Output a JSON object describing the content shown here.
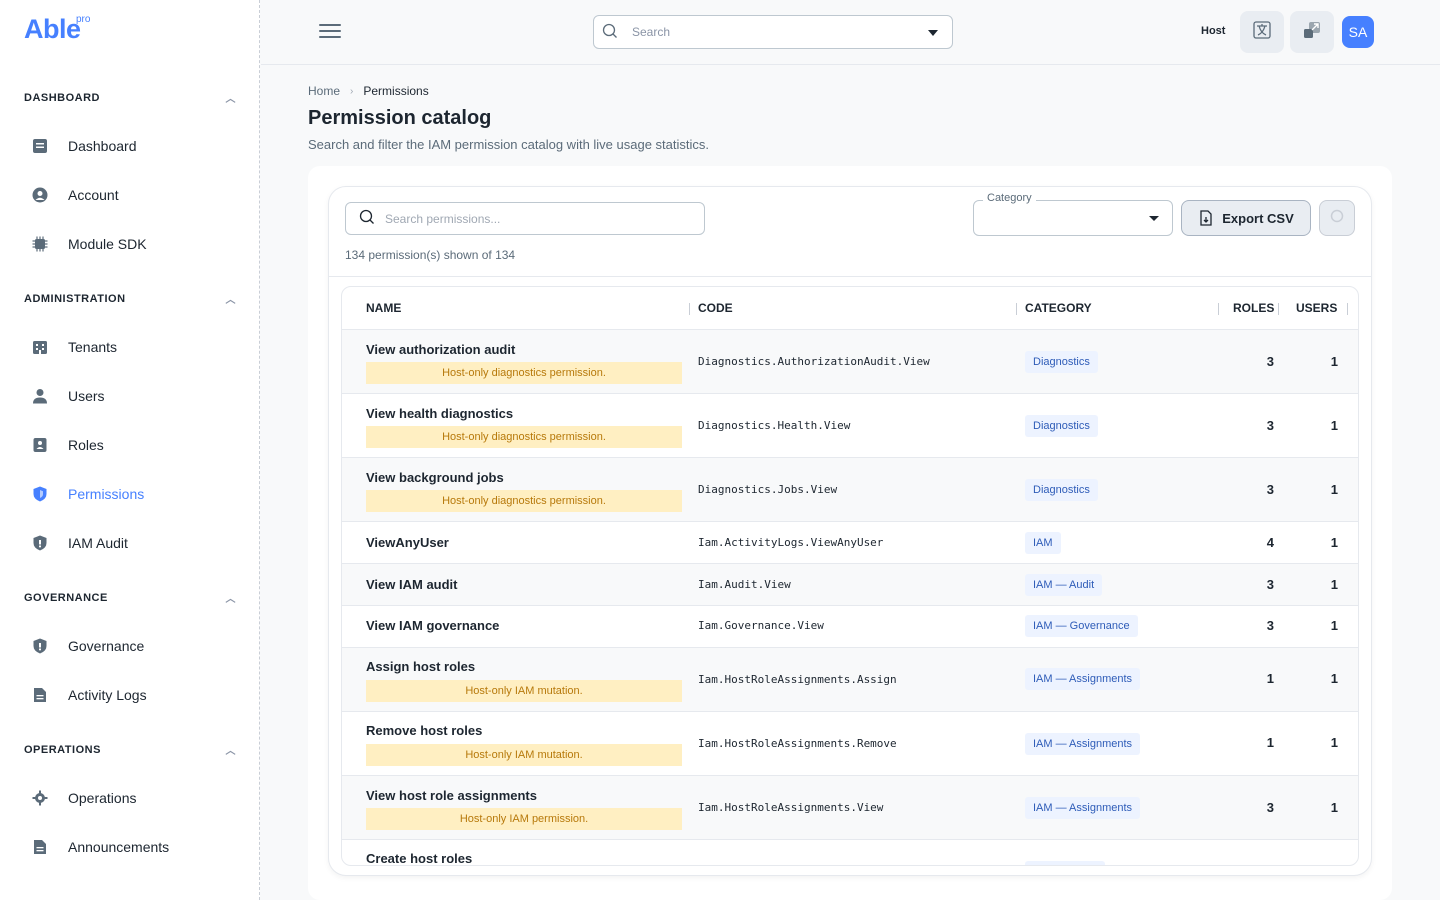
{
  "brand": {
    "name": "Able",
    "badge": "pro",
    "accent": "#4680ff"
  },
  "sidebar": {
    "sections": [
      {
        "label": "DASHBOARD",
        "items": [
          {
            "label": "Dashboard",
            "icon": "dashboard-icon"
          },
          {
            "label": "Account",
            "icon": "account-icon"
          },
          {
            "label": "Module SDK",
            "icon": "chip-icon"
          }
        ]
      },
      {
        "label": "ADMINISTRATION",
        "items": [
          {
            "label": "Tenants",
            "icon": "building-icon"
          },
          {
            "label": "Users",
            "icon": "user-icon"
          },
          {
            "label": "Roles",
            "icon": "roles-icon"
          },
          {
            "label": "Permissions",
            "icon": "shield-icon",
            "active": true
          },
          {
            "label": "IAM Audit",
            "icon": "shield-icon"
          }
        ]
      },
      {
        "label": "GOVERNANCE",
        "items": [
          {
            "label": "Governance",
            "icon": "shield-icon"
          },
          {
            "label": "Activity Logs",
            "icon": "document-icon"
          }
        ]
      },
      {
        "label": "OPERATIONS",
        "items": [
          {
            "label": "Operations",
            "icon": "gear-icon"
          },
          {
            "label": "Announcements",
            "icon": "document-icon"
          }
        ]
      }
    ]
  },
  "topbar": {
    "search_placeholder": "Search",
    "host_label": "Host",
    "avatar_initials": "SA"
  },
  "breadcrumb": {
    "home": "Home",
    "current": "Permissions"
  },
  "page": {
    "title": "Permission catalog",
    "subtitle": "Search and filter the IAM permission catalog with live usage statistics."
  },
  "toolbar": {
    "search_placeholder": "Search permissions...",
    "count_text": "134 permission(s) shown of 134",
    "category_label": "Category",
    "category_value": "",
    "export_label": "Export CSV"
  },
  "table": {
    "columns": {
      "name": "NAME",
      "code": "CODE",
      "category": "CATEGORY",
      "roles": "ROLES",
      "users": "USERS"
    },
    "rows": [
      {
        "name": "View authorization audit",
        "note": "Host-only diagnostics permission.",
        "code": "Diagnostics.AuthorizationAudit.View",
        "category": "Diagnostics",
        "roles": "3",
        "users": "1"
      },
      {
        "name": "View health diagnostics",
        "note": "Host-only diagnostics permission.",
        "code": "Diagnostics.Health.View",
        "category": "Diagnostics",
        "roles": "3",
        "users": "1"
      },
      {
        "name": "View background jobs",
        "note": "Host-only diagnostics permission.",
        "code": "Diagnostics.Jobs.View",
        "category": "Diagnostics",
        "roles": "3",
        "users": "1"
      },
      {
        "name": "ViewAnyUser",
        "note": "",
        "code": "Iam.ActivityLogs.ViewAnyUser",
        "category": "IAM",
        "roles": "4",
        "users": "1"
      },
      {
        "name": "View IAM audit",
        "note": "",
        "code": "Iam.Audit.View",
        "category": "IAM — Audit",
        "roles": "3",
        "users": "1"
      },
      {
        "name": "View IAM governance",
        "note": "",
        "code": "Iam.Governance.View",
        "category": "IAM — Governance",
        "roles": "3",
        "users": "1"
      },
      {
        "name": "Assign host roles",
        "note": "Host-only IAM mutation.",
        "code": "Iam.HostRoleAssignments.Assign",
        "category": "IAM — Assignments",
        "roles": "1",
        "users": "1"
      },
      {
        "name": "Remove host roles",
        "note": "Host-only IAM mutation.",
        "code": "Iam.HostRoleAssignments.Remove",
        "category": "IAM — Assignments",
        "roles": "1",
        "users": "1"
      },
      {
        "name": "View host role assignments",
        "note": "Host-only IAM permission.",
        "code": "Iam.HostRoleAssignments.View",
        "category": "IAM — Assignments",
        "roles": "3",
        "users": "1"
      },
      {
        "name": "Create host roles",
        "note": "",
        "code": "",
        "category": "",
        "roles": "",
        "users": ""
      }
    ]
  }
}
